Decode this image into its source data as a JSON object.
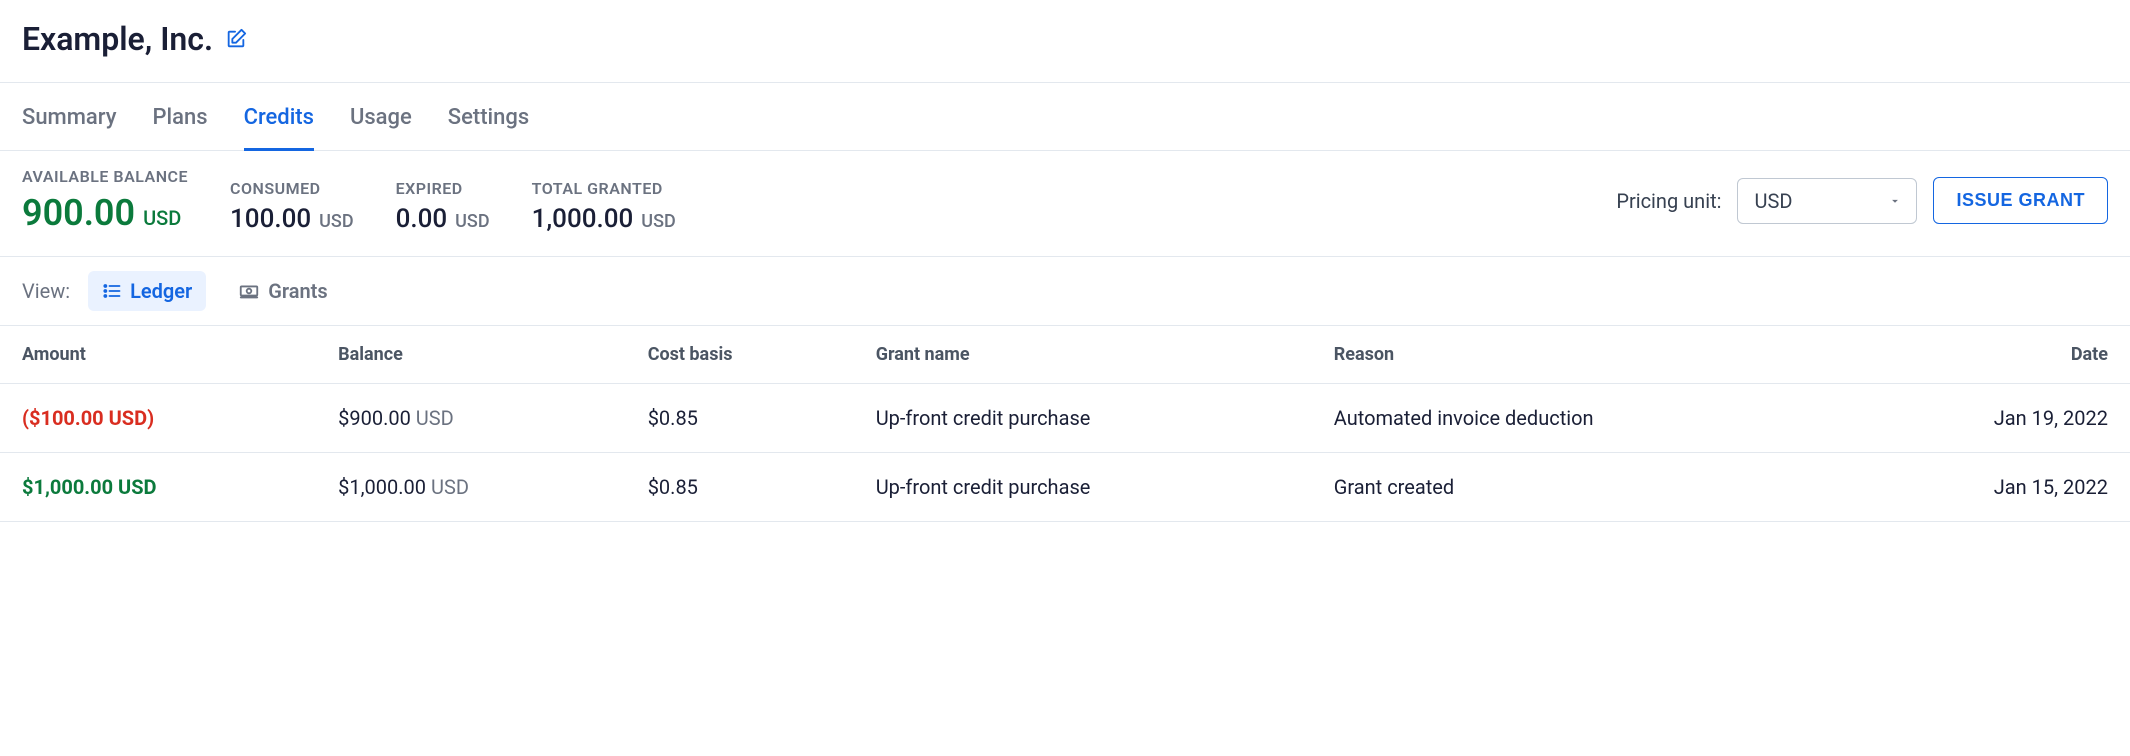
{
  "header": {
    "title": "Example, Inc."
  },
  "tabs": [
    {
      "label": "Summary",
      "active": false
    },
    {
      "label": "Plans",
      "active": false
    },
    {
      "label": "Credits",
      "active": true
    },
    {
      "label": "Usage",
      "active": false
    },
    {
      "label": "Settings",
      "active": false
    }
  ],
  "stats": {
    "available": {
      "label": "AVAILABLE BALANCE",
      "value": "900.00",
      "currency": "USD"
    },
    "consumed": {
      "label": "CONSUMED",
      "value": "100.00",
      "currency": "USD"
    },
    "expired": {
      "label": "EXPIRED",
      "value": "0.00",
      "currency": "USD"
    },
    "total_granted": {
      "label": "TOTAL GRANTED",
      "value": "1,000.00",
      "currency": "USD"
    }
  },
  "pricing_unit": {
    "label": "Pricing unit:",
    "selected": "USD"
  },
  "issue_grant_label": "ISSUE GRANT",
  "view": {
    "label": "View:",
    "ledger": "Ledger",
    "grants": "Grants"
  },
  "table": {
    "columns": {
      "amount": "Amount",
      "balance": "Balance",
      "cost_basis": "Cost basis",
      "grant_name": "Grant name",
      "reason": "Reason",
      "date": "Date"
    },
    "rows": [
      {
        "amount": "($100.00 USD)",
        "amount_sign": "neg",
        "balance_value": "$900.00",
        "balance_currency": "USD",
        "cost_basis": "$0.85",
        "grant_name": "Up-front credit purchase",
        "reason": "Automated invoice deduction",
        "date": "Jan 19, 2022"
      },
      {
        "amount": "$1,000.00 USD",
        "amount_sign": "pos",
        "balance_value": "$1,000.00",
        "balance_currency": "USD",
        "cost_basis": "$0.85",
        "grant_name": "Up-front credit purchase",
        "reason": "Grant created",
        "date": "Jan 15, 2022"
      }
    ]
  }
}
